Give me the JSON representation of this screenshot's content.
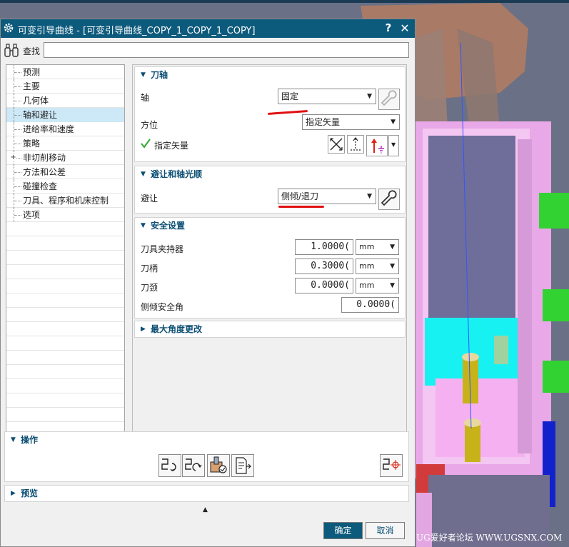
{
  "dialog": {
    "title": "可变引导曲线 - [可变引导曲线_COPY_1_COPY_1_COPY]",
    "help_label": "?",
    "close_label": "✕"
  },
  "find": {
    "label": "查找",
    "value": ""
  },
  "tree": {
    "items": [
      {
        "label": "预测"
      },
      {
        "label": "主要"
      },
      {
        "label": "几何体"
      },
      {
        "label": "轴和避让"
      },
      {
        "label": "进给率和速度"
      },
      {
        "label": "策略"
      },
      {
        "label": "非切削移动"
      },
      {
        "label": "方法和公差"
      },
      {
        "label": "碰撞检查"
      },
      {
        "label": "刀具、程序和机床控制"
      },
      {
        "label": "选项"
      }
    ],
    "selected_index": 3
  },
  "tool_axis": {
    "header": "刀轴",
    "axis_label": "轴",
    "axis_value": "固定",
    "orient_label": "方位",
    "orient_value": "指定矢量",
    "vector_label": "指定矢量"
  },
  "avoid": {
    "header": "避让和轴光顺",
    "avoid_label": "避让",
    "avoid_value": "侧倾/退刀"
  },
  "safety": {
    "header": "安全设置",
    "holder_label": "刀具夹持器",
    "holder_value": "1.0000(",
    "holder_unit": "mm",
    "shank_label": "刀柄",
    "shank_value": "0.3000(",
    "shank_unit": "mm",
    "neck_label": "刀颈",
    "neck_value": "0.0000(",
    "neck_unit": "mm",
    "tilt_label": "侧倾安全角",
    "tilt_value": "0.0000("
  },
  "max_angle": {
    "header": "最大角度更改"
  },
  "operations": {
    "header": "操作"
  },
  "preview": {
    "header": "预览"
  },
  "footer": {
    "ok": "确定",
    "cancel": "取消"
  },
  "watermark": "UG爱好者论坛 WWW.UGSNX.COM",
  "colors": {
    "titlebar": "#0c5a7c",
    "accent": "#0c4f74",
    "selected_row": "#cde8f7",
    "annotation_red": "#e01010"
  }
}
